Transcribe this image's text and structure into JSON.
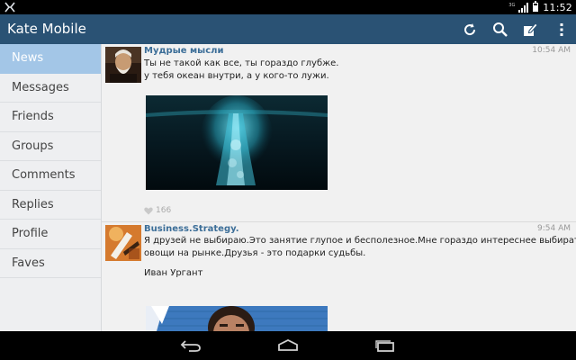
{
  "status_bar": {
    "time": "11:52",
    "network": "3G"
  },
  "app": {
    "title": "Kate Mobile"
  },
  "toolbar": {
    "icons": [
      "refresh-icon",
      "search-icon",
      "compose-icon",
      "overflow-menu-icon"
    ]
  },
  "sidebar": {
    "items": [
      {
        "label": "News",
        "active": true
      },
      {
        "label": "Messages"
      },
      {
        "label": "Friends"
      },
      {
        "label": "Groups"
      },
      {
        "label": "Comments"
      },
      {
        "label": "Replies"
      },
      {
        "label": "Profile"
      },
      {
        "label": "Faves"
      }
    ]
  },
  "feed": {
    "posts": [
      {
        "author": "Мудрые мысли",
        "time": "10:54 AM",
        "lines": [
          "Ты не такой как все, ты гораздо глубже.",
          "у тебя океан внутри, а у кого-то лужи."
        ],
        "likes": "166"
      },
      {
        "author": "Business.Strategy.",
        "time": "9:54 AM",
        "lines": [
          "Я друзей не выбираю.Это занятие глупое и бесполезное.Мне гораздо интереснее выбирать",
          "овощи на рынке.Друзья - это подарки судьбы."
        ],
        "signature": "Иван Ургант"
      }
    ]
  },
  "colors": {
    "action_bar": "#2a5274",
    "sidebar_active": "#a3c6e7",
    "author_link": "#3c6e98",
    "feed_background": "#f1f1f1"
  }
}
